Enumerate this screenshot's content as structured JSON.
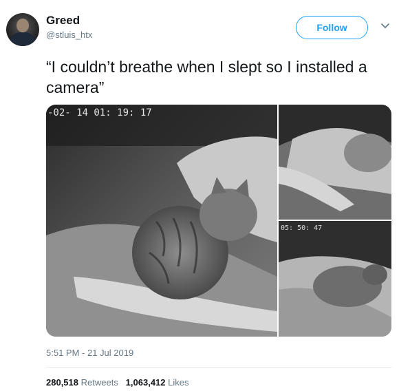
{
  "user": {
    "display_name": "Greed",
    "handle": "@stluis_htx",
    "avatar_icon": "avatar-image"
  },
  "follow_label": "Follow",
  "more_icon": "chevron-down-icon",
  "tweet_text": "“I couldn’t breathe when I slept so I installed a camera”",
  "media": {
    "main_overlay": "-02- 14   01: 19: 17",
    "top_right_overlay": "",
    "bottom_right_overlay": "05: 50: 47"
  },
  "timestamp": "5:51 PM - 21 Jul 2019",
  "stats": {
    "retweets_count": "280,518",
    "retweets_label": "Retweets",
    "likes_count": "1,063,412",
    "likes_label": "Likes"
  },
  "colors": {
    "accent": "#1da1f2",
    "secondary_text": "#657786"
  }
}
